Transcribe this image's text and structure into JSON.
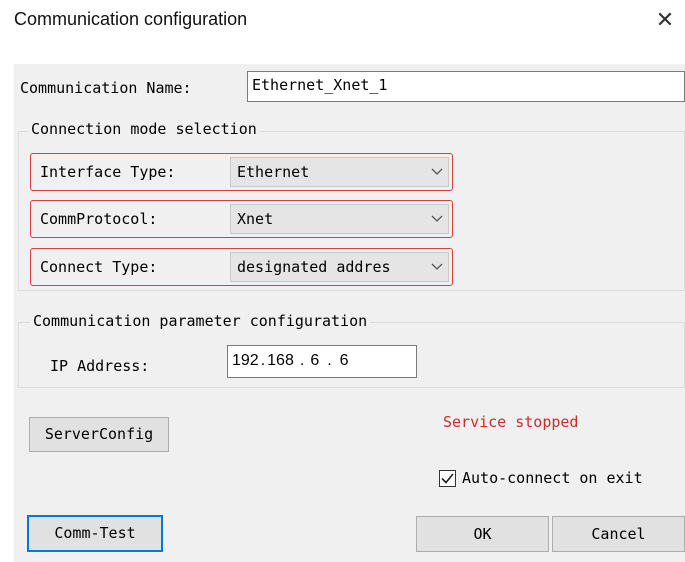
{
  "window": {
    "title": "Communication configuration",
    "close_glyph": "✕"
  },
  "comm_name": {
    "label": "Communication Name:",
    "value": "Ethernet_Xnet_1"
  },
  "connection_mode": {
    "legend": "Connection mode selection",
    "interface_type": {
      "label": "Interface Type:",
      "value": "Ethernet"
    },
    "comm_protocol": {
      "label": "CommProtocol:",
      "value": "Xnet"
    },
    "connect_type": {
      "label": "Connect Type:",
      "value": "designated addres"
    }
  },
  "param_config": {
    "legend": "Communication parameter configuration",
    "ip_label": "IP Address:",
    "ip_octets": [
      "192",
      "168",
      "6",
      "6"
    ]
  },
  "server_config_label": "ServerConfig",
  "status_text": "Service stopped",
  "auto_connect": {
    "label": "Auto-connect on exit",
    "checked": true
  },
  "buttons": {
    "comm_test": "Comm-Test",
    "ok": "OK",
    "cancel": "Cancel"
  },
  "colors": {
    "highlight_border": "#d9403a",
    "status": "#d12a2a",
    "focus": "#0078d7",
    "panel": "#f0f0f0"
  }
}
